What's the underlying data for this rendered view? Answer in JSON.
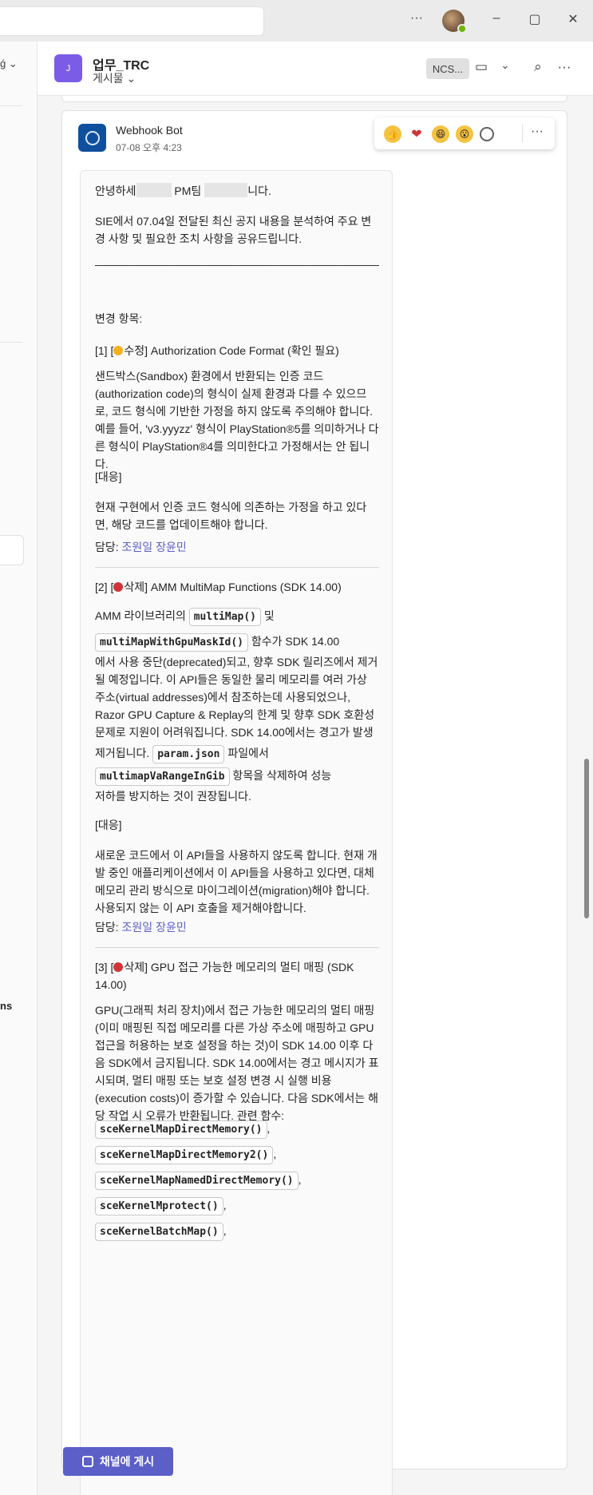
{
  "header": {
    "channel_avatar": "J",
    "channel_name": "업무_TRC",
    "channel_tab": "게시물 ⌄",
    "ncs_label": "NCS...",
    "window_controls": {
      "more": "···",
      "minimize": "–",
      "restore": "▢",
      "close": "✕"
    }
  },
  "message": {
    "sender": "Webhook Bot",
    "timestamp": "07-08 오후 4:23",
    "reactions": [
      "👍",
      "❤",
      "😆",
      "😮"
    ],
    "more": "···"
  },
  "card": {
    "greeting_a": "안녕하세",
    "greeting_b": "PM팀 ",
    "greeting_c": "니다.",
    "intro": "SIE에서 07.04일 전달된 최신 공지 내용을 분석하여 주요 변경 사항 및 필요한 조치 사항을 공유드립니다.",
    "rule": "——————————————————————————————————————————————————————",
    "changes_label": "변경 항목:",
    "item1_title_a": "[1] [",
    "item1_title_b": "수정] Authorization Code Format (확인 필요)",
    "item1_body": "샌드박스(Sandbox) 환경에서 반환되는 인증 코드(authorization code)의 형식이 실제 환경과 다를 수 있으므로, 코드 형식에 기반한 가정을 하지 않도록 주의해야 합니다. 예를 들어, 'v3.yyyzz' 형식이 PlayStation®5를 의미하거나 다른 형식이 PlayStation®4를 의미한다고 가정해서는 안 됩니다.",
    "response_label": "[대응]",
    "item1_response": "현재 구현에서 인증 코드 형식에 의존하는 가정을 하고 있다면, 해당 코드를 업데이트해야 합니다.",
    "owner_label": "담당: ",
    "owner_names": "조원일 장윤민",
    "item2_title_a": "[2] [",
    "item2_title_b": "삭제] AMM MultiMap Functions (SDK 14.00)",
    "item2_b1": "AMM 라이브러리의 ",
    "item2_c1": "multiMap()",
    "item2_b2": " 및",
    "item2_c2": "multiMapWithGpuMaskId()",
    "item2_b3": " 함수가 SDK 14.00",
    "item2_b4": "에서 사용 중단(deprecated)되고, 향후 SDK 릴리즈에서 제거될 예정입니다. 이 API들은 동일한 물리 메모리를 여러 가상 주소(virtual addresses)에서 참조하는데 사용되었으나, Razor GPU Capture & Replay의 한계 및 향후 SDK 호환성 문제로 지원이 어려워집니다. SDK 14.00에서는 경고가 발생하며, 향후 SDK에서는",
    "item2_b5": "제거됩니다. ",
    "item2_c3": "param.json",
    "item2_b6": " 파일에서",
    "item2_c4": "multimapVaRangeInGib",
    "item2_b7": " 항목을 삭제하여 성능",
    "item2_b8": "저하를 방지하는 것이 권장됩니다.",
    "item2_response": "새로운 코드에서 이 API들을 사용하지 않도록 합니다. 현재 개발 중인 애플리케이션에서 이 API들을 사용하고 있다면, 대체 메모리 관리 방식으로 마이그레이션(migration)해야 합니다. 사용되지 않는 이 API 호출을 제거해야합니다.",
    "item3_title_a": "[3] [",
    "item3_title_b": "삭제] GPU 접근 가능한 메모리의 멀티 매핑 (SDK 14.00)",
    "item3_body": "GPU(그래픽 처리 장치)에서 접근 가능한 메모리의 멀티 매핑(이미 매핑된 직접 메모리를 다른 가상 주소에 매핑하고 GPU 접근을 허용하는 보호 설정을 하는 것)이 SDK 14.00 이후 다음 SDK에서 금지됩니다. SDK 14.00에서는 경고 메시지가 표시되며, 멀티 매핑 또는 보호 설정 변경 시 실행 비용(execution costs)이 증가할 수 있습니다. 다음 SDK에서는 해당 작업 시 오류가 반환됩니다. 관련 함수:",
    "funcs": [
      "sceKernelMapDirectMemory()",
      "sceKernelMapDirectMemory2()",
      "sceKernelMapNamedDirectMemory()",
      "sceKernelMprotect()",
      "sceKernelBatchMap()"
    ],
    "func_sep": ","
  },
  "footer": {
    "post_button": "채널에 게시"
  },
  "colors": {
    "accent": "#5b5fc7",
    "modified_dot": "#f2b21b",
    "deleted_dot": "#d13438"
  }
}
